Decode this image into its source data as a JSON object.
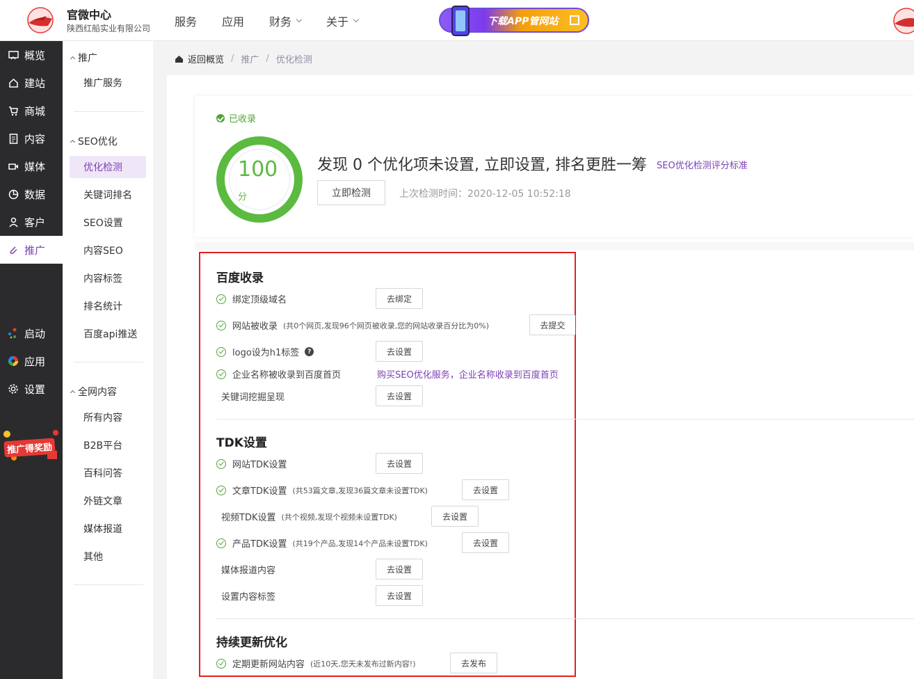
{
  "header": {
    "brand_title": "官微中心",
    "brand_sub": "陕西红船实业有限公司",
    "nav": [
      {
        "label": "服务",
        "has_menu": false
      },
      {
        "label": "应用",
        "has_menu": false
      },
      {
        "label": "财务",
        "has_menu": true
      },
      {
        "label": "关于",
        "has_menu": true
      }
    ],
    "promo_label": "下载APP管网站"
  },
  "sidebar": {
    "items": [
      {
        "label": "概览",
        "icon": "chart-board-icon"
      },
      {
        "label": "建站",
        "icon": "home-icon"
      },
      {
        "label": "商城",
        "icon": "cart-icon"
      },
      {
        "label": "内容",
        "icon": "document-icon"
      },
      {
        "label": "媒体",
        "icon": "video-icon"
      },
      {
        "label": "数据",
        "icon": "pie-icon"
      },
      {
        "label": "客户",
        "icon": "user-icon"
      },
      {
        "label": "推广",
        "icon": "paperclip-icon",
        "active": true
      },
      {
        "label": "启动",
        "icon": "dots-icon"
      },
      {
        "label": "应用",
        "icon": "color-wheel-icon"
      },
      {
        "label": "设置",
        "icon": "gear-icon"
      }
    ],
    "promo_badge": "推广得奖励"
  },
  "subnav": {
    "groups": [
      {
        "title": "推广",
        "items": [
          "推广服务"
        ]
      },
      {
        "title": "SEO优化",
        "items": [
          "优化检测",
          "关键词排名",
          "SEO设置",
          "内容SEO",
          "内容标签",
          "排名统计",
          "百度api推送"
        ]
      },
      {
        "title": "全网内容",
        "items": [
          "所有内容",
          "B2B平台",
          "百科问答",
          "外链文章",
          "媒体报道",
          "其他"
        ]
      }
    ],
    "active_item": "优化检测"
  },
  "breadcrumb": {
    "home": "返回概览",
    "items": [
      "推广",
      "优化检测"
    ]
  },
  "score": {
    "status": "已收录",
    "value": "100",
    "unit": "分",
    "headline": "发现 0 个优化项未设置, 立即设置, 排名更胜一筹",
    "criteria_link": "SEO优化检测评分标准",
    "check_button": "立即检测",
    "last_check": "上次检测时间：2020-12-05 10:52:18"
  },
  "sections": {
    "baidu": {
      "title": "百度收录",
      "rows": [
        {
          "label": "绑定顶级域名",
          "note": "",
          "button": "去绑定",
          "ok": true
        },
        {
          "label": "网站被收录",
          "note": "(共0个网页,发现96个网页被收录,您的网站收录百分比为0%)",
          "button": "去提交",
          "ok": true
        },
        {
          "label": "logo设为h1标签",
          "note": "",
          "button": "去设置",
          "ok": true
        },
        {
          "label": "企业名称被收录到百度首页",
          "note": "",
          "link": "购买SEO优化服务，企业名称收录到百度首页",
          "ok": true
        },
        {
          "label": "关键词挖掘呈现",
          "note": "",
          "button": "去设置",
          "ok": false
        }
      ]
    },
    "tdk": {
      "title": "TDK设置",
      "rows": [
        {
          "label": "网站TDK设置",
          "note": "",
          "button": "去设置",
          "ok": true
        },
        {
          "label": "文章TDK设置",
          "note": "(共53篇文章,发现36篇文章未设置TDK)",
          "button": "去设置",
          "ok": true
        },
        {
          "label": "视频TDK设置",
          "note": "(共个视频,发现个视频未设置TDK)",
          "button": "去设置",
          "ok": false
        },
        {
          "label": "产品TDK设置",
          "note": "(共19个产品,发现14个产品未设置TDK)",
          "button": "去设置",
          "ok": true
        },
        {
          "label": "媒体报道内容",
          "note": "",
          "button": "去设置",
          "ok": false
        },
        {
          "label": "设置内容标签",
          "note": "",
          "button": "去设置",
          "ok": false
        }
      ]
    },
    "update": {
      "title": "持续更新优化",
      "rows": [
        {
          "label": "定期更新网站内容",
          "note": "(近10天,您天未发布过新内容!)",
          "button": "去发布",
          "ok": true
        }
      ]
    }
  },
  "colors": {
    "accent": "#7b3fb3",
    "success": "#52a535",
    "highlight_border": "#e02020",
    "sidebar_bg": "#2b2b2d"
  }
}
